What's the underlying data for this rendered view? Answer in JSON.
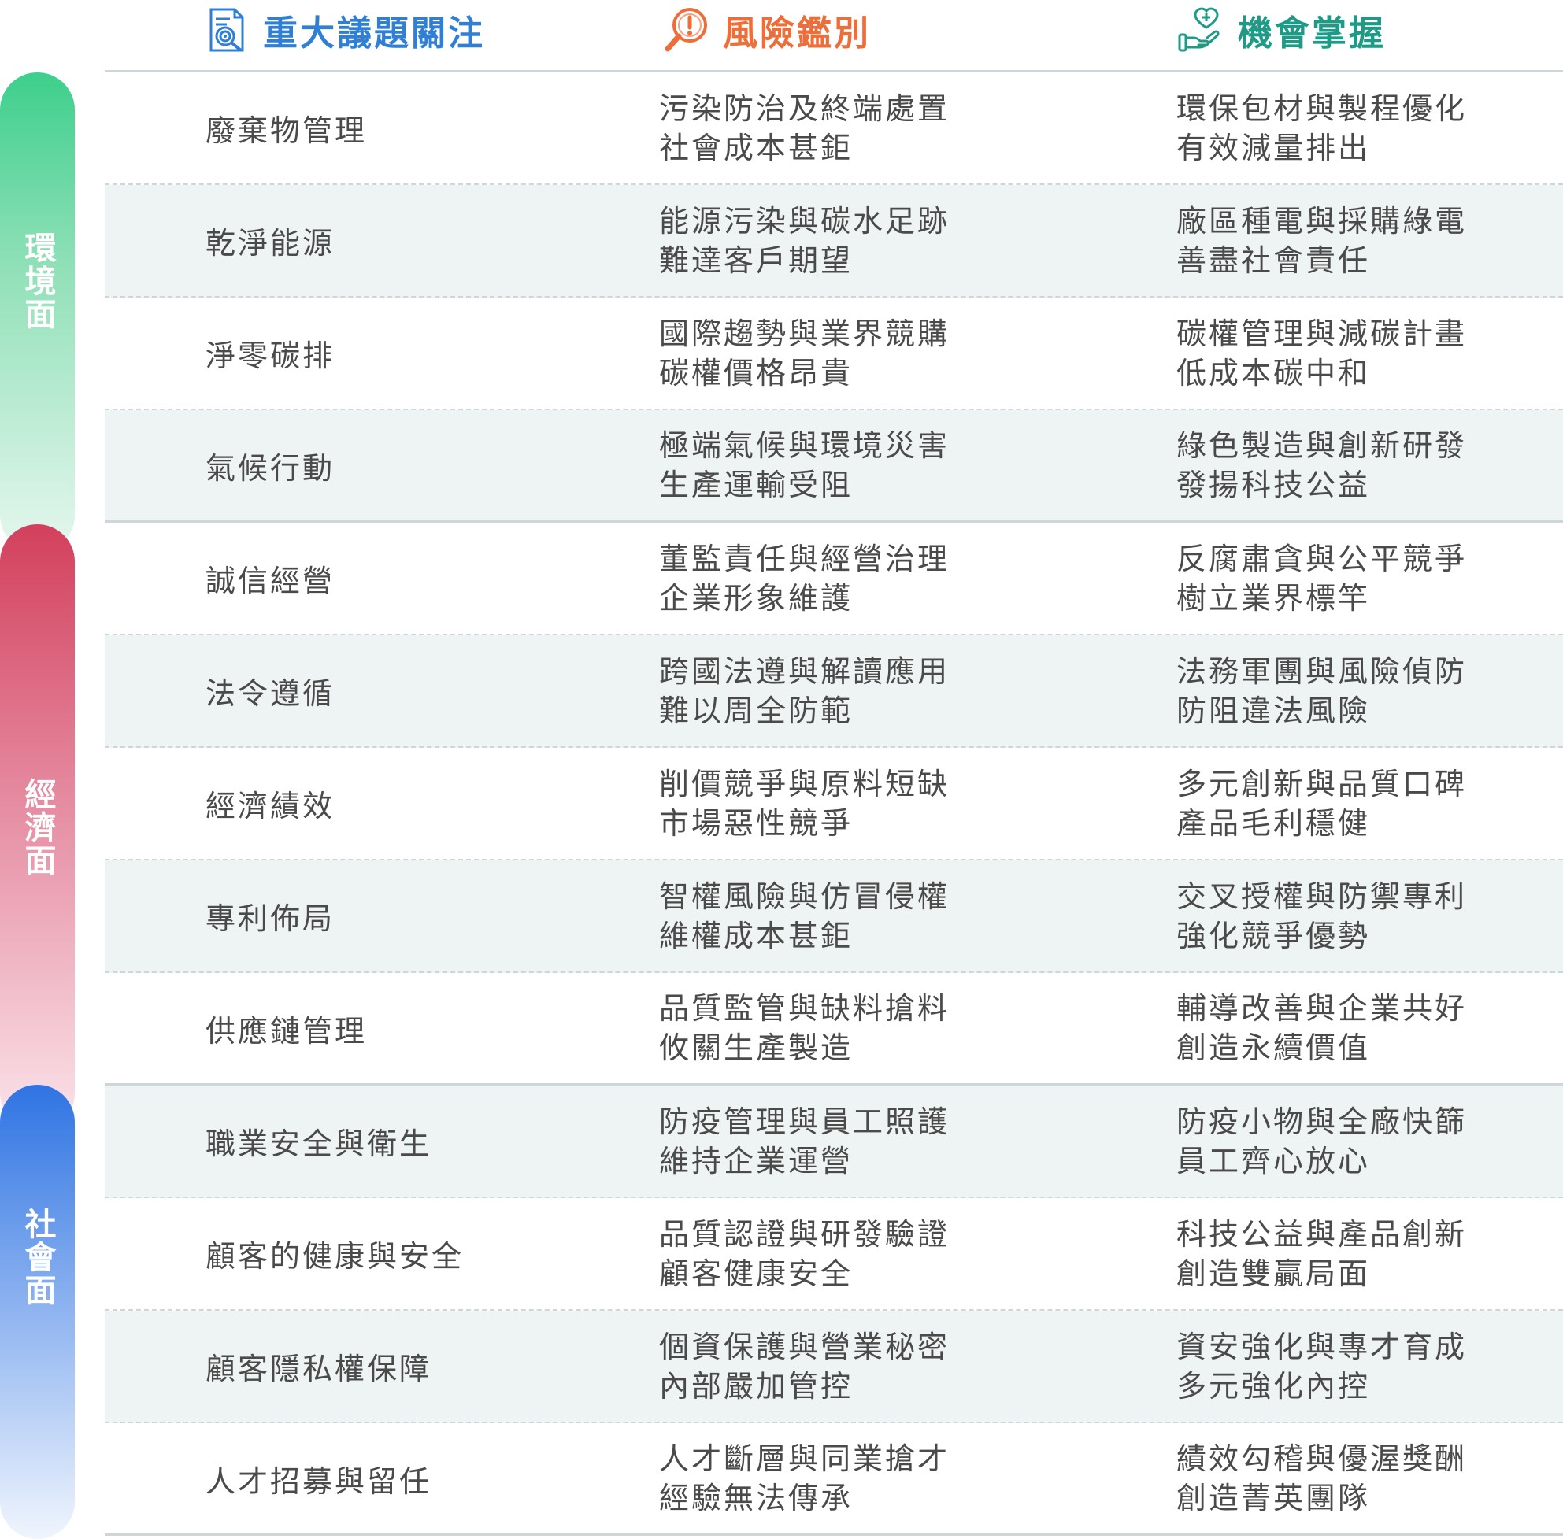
{
  "headers": {
    "topic": "重大議題關注",
    "risk": "風險鑑別",
    "opportunity": "機會掌握"
  },
  "categories": {
    "environment": "環境面",
    "economy": "經濟面",
    "society": "社會面"
  },
  "colors": {
    "topic_header": "#2f7fd6",
    "risk_header": "#ee6e3a",
    "opportunity_header": "#1f9a86",
    "environment": "#3dcf8c",
    "economy": "#d2405c",
    "society": "#2f74e3"
  },
  "icons": {
    "topic": "report-icon",
    "risk": "warning-magnifier-icon",
    "opportunity": "hand-heart-icon"
  },
  "rows": [
    {
      "topic": "廢棄物管理",
      "risk": [
        "污染防治及終端處置",
        "社會成本甚鉅"
      ],
      "opportunity": [
        "環保包材與製程優化",
        "有效減量排出"
      ]
    },
    {
      "topic": "乾淨能源",
      "risk": [
        "能源污染與碳水足跡",
        "難達客戶期望"
      ],
      "opportunity": [
        "廠區種電與採購綠電",
        "善盡社會責任"
      ]
    },
    {
      "topic": "淨零碳排",
      "risk": [
        "國際趨勢與業界競購",
        "碳權價格昂貴"
      ],
      "opportunity": [
        "碳權管理與減碳計畫",
        "低成本碳中和"
      ]
    },
    {
      "topic": "氣候行動",
      "risk": [
        "極端氣候與環境災害",
        "生產運輸受阻"
      ],
      "opportunity": [
        "綠色製造與創新研發",
        "發揚科技公益"
      ]
    },
    {
      "topic": "誠信經營",
      "risk": [
        "董監責任與經營治理",
        "企業形象維護"
      ],
      "opportunity": [
        "反腐肅貪與公平競爭",
        "樹立業界標竿"
      ]
    },
    {
      "topic": "法令遵循",
      "risk": [
        "跨國法遵與解讀應用",
        "難以周全防範"
      ],
      "opportunity": [
        "法務軍團與風險偵防",
        "防阻違法風險"
      ]
    },
    {
      "topic": "經濟績效",
      "risk": [
        "削價競爭與原料短缺",
        "市場惡性競爭"
      ],
      "opportunity": [
        "多元創新與品質口碑",
        "產品毛利穩健"
      ]
    },
    {
      "topic": "專利佈局",
      "risk": [
        "智權風險與仿冒侵權",
        "維權成本甚鉅"
      ],
      "opportunity": [
        "交叉授權與防禦專利",
        "強化競爭優勢"
      ]
    },
    {
      "topic": "供應鏈管理",
      "risk": [
        "品質監管與缺料搶料",
        "攸關生產製造"
      ],
      "opportunity": [
        "輔導改善與企業共好",
        "創造永續價值"
      ]
    },
    {
      "topic": "職業安全與衛生",
      "risk": [
        "防疫管理與員工照護",
        "維持企業運營"
      ],
      "opportunity": [
        "防疫小物與全廠快篩",
        "員工齊心放心"
      ]
    },
    {
      "topic": "顧客的健康與安全",
      "risk": [
        "品質認證與研發驗證",
        "顧客健康安全"
      ],
      "opportunity": [
        "科技公益與產品創新",
        "創造雙贏局面"
      ]
    },
    {
      "topic": "顧客隱私權保障",
      "risk": [
        "個資保護與營業秘密",
        "內部嚴加管控"
      ],
      "opportunity": [
        "資安強化與專才育成",
        "多元強化內控"
      ]
    },
    {
      "topic": "人才招募與留任",
      "risk": [
        "人才斷層與同業搶才",
        "經驗無法傳承"
      ],
      "opportunity": [
        "績效勾稽與優渥獎酬",
        "創造菁英團隊"
      ]
    }
  ]
}
